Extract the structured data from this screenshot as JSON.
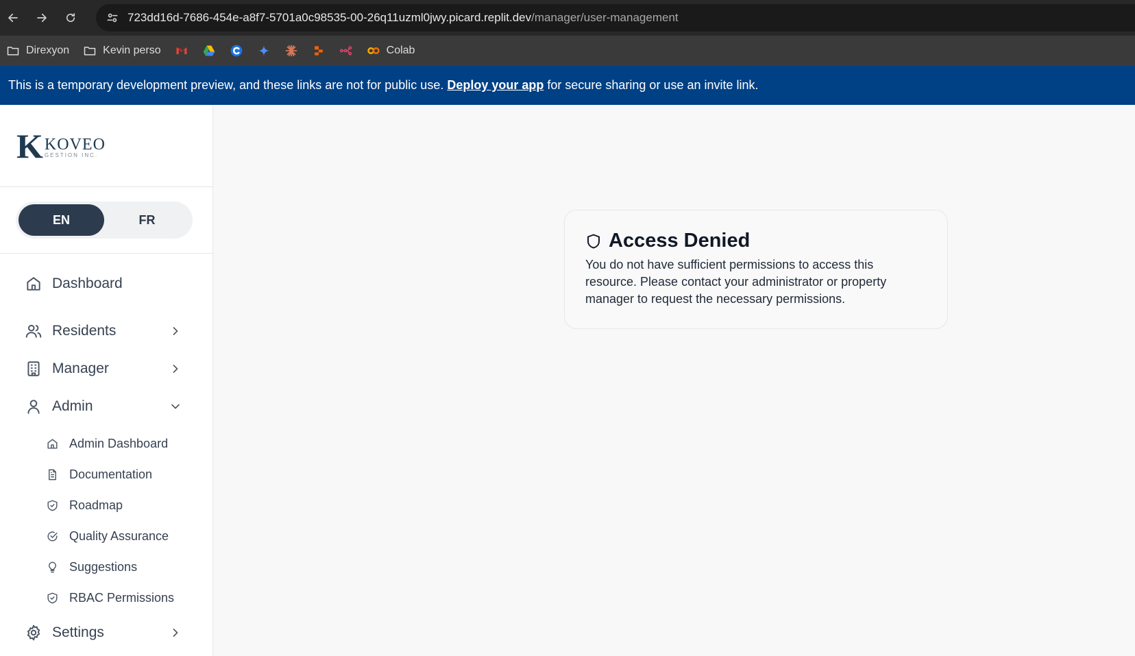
{
  "browser": {
    "url_host": "723dd16d-7686-454e-a8f7-5701a0c98535-00-26q11uzml0jwy.picard.replit.dev",
    "url_path": "/manager/user-management",
    "bookmarks": [
      {
        "label": "Direxyon",
        "icon": "folder-icon"
      },
      {
        "label": "Kevin perso",
        "icon": "folder-icon"
      },
      {
        "label": "Colab",
        "icon": "colab-icon"
      }
    ]
  },
  "banner": {
    "text_before": "This is a temporary development preview, and these links are not for public use.",
    "link": "Deploy your app",
    "text_after": "for secure sharing or use an invite link."
  },
  "logo": {
    "letter": "K",
    "name": "KOVEO",
    "sub": "GESTION INC."
  },
  "lang": {
    "en": "EN",
    "fr": "FR",
    "active": "EN"
  },
  "nav": {
    "dashboard": "Dashboard",
    "residents": "Residents",
    "manager": "Manager",
    "admin": "Admin",
    "admin_items": [
      "Admin Dashboard",
      "Documentation",
      "Roadmap",
      "Quality Assurance",
      "Suggestions",
      "RBAC Permissions"
    ],
    "settings": "Settings"
  },
  "card": {
    "title": "Access Denied",
    "message": "You do not have sufficient permissions to access this resource. Please contact your administrator or property manager to request the necessary permissions."
  },
  "colors": {
    "banner": "#004085",
    "lang_active": "#2d3b4f"
  }
}
